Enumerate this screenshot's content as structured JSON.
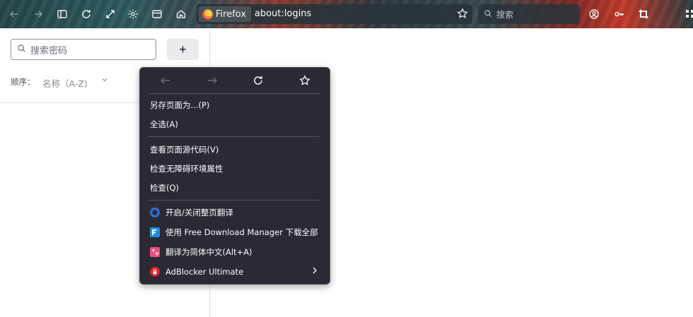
{
  "toolbar": {
    "url_identity_label": "Firefox",
    "url_text": "about:logins",
    "search_placeholder": "搜索",
    "icons": [
      "back-icon",
      "forward-icon",
      "sidebar-icon",
      "reload-icon",
      "fullscreen-icon",
      "settings-icon",
      "tab-view-icon",
      "home-icon",
      "firefox-logo-icon",
      "bookmark-star-icon",
      "search-icon",
      "account-icon",
      "key-icon",
      "crop-icon",
      "extensions-icon"
    ]
  },
  "logins": {
    "search_placeholder": "搜索密码",
    "add_label": "+",
    "sort_label": "顺序：",
    "sort_value": "名称（A-Z)"
  },
  "context_menu": {
    "nav_icons": [
      "back-icon",
      "forward-icon",
      "reload-icon",
      "bookmark-star-icon"
    ],
    "items": [
      {
        "label": "另存页面为...(P)"
      },
      {
        "label": "全选(A)"
      },
      {
        "label": "查看页面源代码(V)"
      },
      {
        "label": "检查无障碍环境属性"
      },
      {
        "label": "检查(Q)"
      },
      {
        "label": "开启/关闭整页翻译",
        "icon": "translate-icon"
      },
      {
        "label": "使用 Free Download Manager 下载全部",
        "icon": "fdm-icon"
      },
      {
        "label": "翻译为简体中文(Alt+A)",
        "icon": "translate-zh-icon"
      },
      {
        "label": "AdBlocker Ultimate",
        "icon": "adblocker-icon",
        "submenu": true
      }
    ]
  },
  "colors": {
    "menu_bg": "#2b2a33",
    "menu_text": "#fbfbfe",
    "add_button_bg": "#ebebee"
  }
}
